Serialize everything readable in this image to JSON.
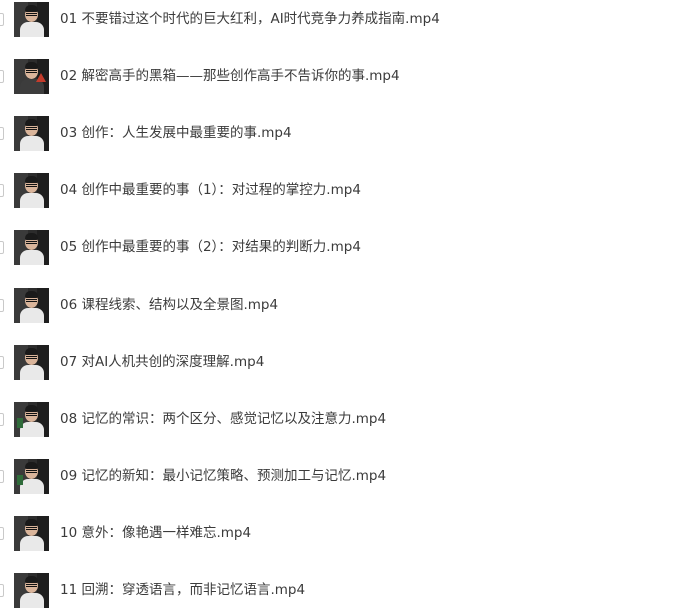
{
  "files": [
    {
      "name": "01 不要错过这个时代的巨大红利，AI时代竞争力养成指南.mp4",
      "thumbnail": "video-thumbnail",
      "variant": "plain"
    },
    {
      "name": "02 解密高手的黑箱——那些创作高手不告诉你的事.mp4",
      "thumbnail": "video-thumbnail",
      "variant": "red"
    },
    {
      "name": "03 创作：人生发展中最重要的事.mp4",
      "thumbnail": "video-thumbnail",
      "variant": "plain"
    },
    {
      "name": "04 创作中最重要的事（1）：对过程的掌控力.mp4",
      "thumbnail": "video-thumbnail",
      "variant": "plain"
    },
    {
      "name": "05 创作中最重要的事（2）：对结果的判断力.mp4",
      "thumbnail": "video-thumbnail",
      "variant": "plain"
    },
    {
      "name": "06 课程线索、结构以及全景图.mp4",
      "thumbnail": "video-thumbnail",
      "variant": "plain"
    },
    {
      "name": "07 对AI人机共创的深度理解.mp4",
      "thumbnail": "video-thumbnail",
      "variant": "plain"
    },
    {
      "name": "08 记忆的常识：两个区分、感觉记忆以及注意力.mp4",
      "thumbnail": "video-thumbnail",
      "variant": "green"
    },
    {
      "name": "09 记忆的新知：最小记忆策略、预测加工与记忆.mp4",
      "thumbnail": "video-thumbnail",
      "variant": "green"
    },
    {
      "name": "10 意外：像艳遇一样难忘.mp4",
      "thumbnail": "video-thumbnail",
      "variant": "plain"
    },
    {
      "name": "11 回溯：穿透语言，而非记忆语言.mp4",
      "thumbnail": "video-thumbnail",
      "variant": "plain"
    }
  ],
  "colors": {
    "text": "#3b3b3b",
    "background": "#ffffff",
    "checkbox_border": "#c9c9c9"
  }
}
